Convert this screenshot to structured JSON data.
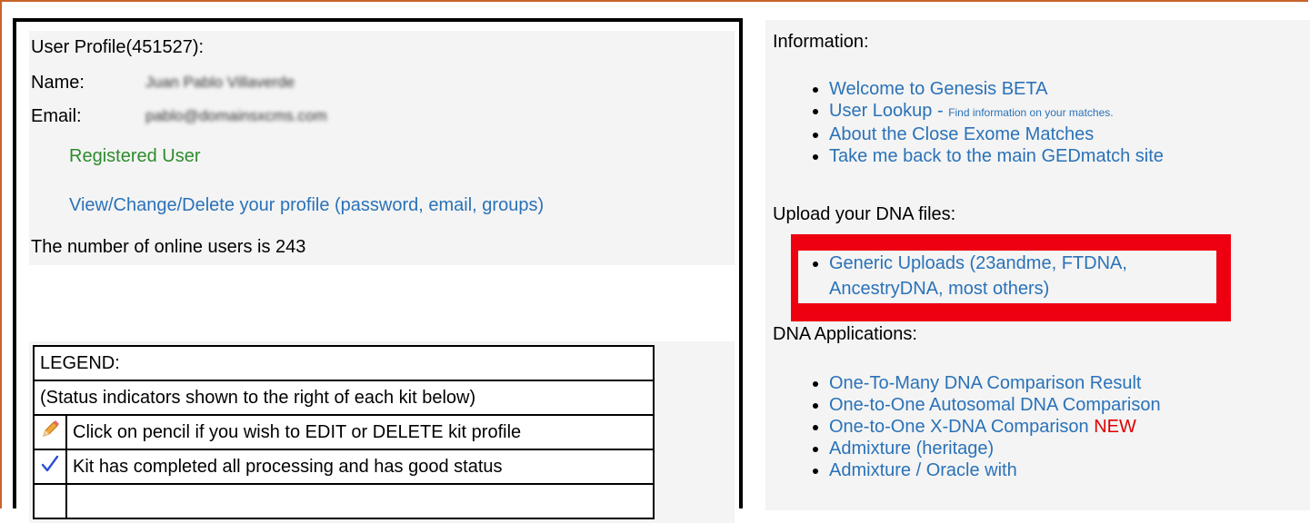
{
  "profile": {
    "title": "User Profile(451527):",
    "name_label": "Name:",
    "name_value": "Juan Pablo Villaverde",
    "email_label": "Email:",
    "email_value": "pablo@domainsxcms.com",
    "status": "Registered User",
    "edit_link": "View/Change/Delete your profile (password, email, groups)",
    "online_users": "The number of online users is 243"
  },
  "legend": {
    "header": "LEGEND:",
    "subheader": "(Status indicators shown to the right of each kit below)",
    "rows": [
      {
        "icon": "pencil-icon",
        "text": "Click on pencil if you wish to EDIT or DELETE kit profile"
      },
      {
        "icon": "checkmark-icon",
        "text": "Kit has completed all processing and has good status"
      }
    ]
  },
  "info": {
    "heading": "Information:",
    "links": [
      {
        "label": "Welcome to Genesis BETA"
      },
      {
        "label": "User Lookup",
        "suffix": " - ",
        "note": "Find information on your matches."
      },
      {
        "label": "About the Close Exome Matches"
      },
      {
        "label": "Take me back to the main GEDmatch site"
      }
    ]
  },
  "upload": {
    "heading": "Upload your DNA files:",
    "link_line1": "Generic Uploads (23andme, FTDNA,",
    "link_line2": "AncestryDNA, most others)"
  },
  "apps": {
    "heading": "DNA Applications:",
    "links": [
      {
        "label": "One-To-Many DNA Comparison Result"
      },
      {
        "label": "One-to-One Autosomal DNA Comparison"
      },
      {
        "label": "One-to-One X-DNA Comparison",
        "badge": "NEW"
      },
      {
        "label": "Admixture (heritage)"
      },
      {
        "label": "Admixture / Oracle with"
      }
    ]
  },
  "colors": {
    "link": "#2a72b8",
    "registered": "#2c8c2c",
    "highlight": "#ee0011",
    "new_badge": "#e00000",
    "frame": "#c8642a"
  }
}
